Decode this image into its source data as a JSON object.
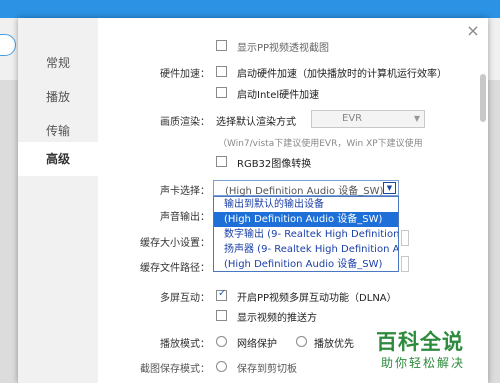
{
  "background": {
    "right_icon": "≡"
  },
  "dialog": {
    "close_label": "×",
    "sidebar": {
      "items": [
        {
          "label": "常规"
        },
        {
          "label": "播放"
        },
        {
          "label": "传输"
        },
        {
          "label": "高级"
        }
      ],
      "active": "高级"
    },
    "rows": {
      "top_partial": "显示PP视频透视截图",
      "hw_accel_label": "硬件加速：",
      "hw_accel_option": "启动硬件加速（加快播放时的计算机运行效率）",
      "intel_option": "启动Intel硬件加速",
      "render_label": "画质渲染：",
      "render_choose": "选择默认渲染方式",
      "render_value": "EVR",
      "render_hint": "（Win7/vista下建议使用EVR，Win XP下建议使用",
      "rgb32_option": "RGB32图像转换",
      "sound_card_label": "声卡选择：",
      "sound_card_value": "(High Definition Audio 设备_SW)",
      "sound_output_label": "声音输出：",
      "cache_size_label": "缓存大小设置：",
      "cache_path_label": "缓存文件路径：",
      "multiscreen_label": "多屏互动：",
      "multiscreen_option": "开启PP视频多屏互动功能（DLNA）",
      "push_option": "显示视频的推送方",
      "play_mode_label": "播放模式：",
      "play_mode_network": "网络保护",
      "play_mode_play": "播放优先",
      "screenshot_label": "截图保存模式：",
      "screenshot_option": "保存到剪切板"
    },
    "sound_dropdown": {
      "options": [
        "输出到默认的输出设备",
        "(High Definition Audio 设备_SW)",
        "数字输出 (9- Realtek High Definition Audio_SW)",
        "扬声器 (9- Realtek High Definition Audio_SW)",
        "(High Definition Audio 设备_SW)"
      ],
      "selected_index": 1
    },
    "checks": {
      "top_partial": false,
      "hw_accel": false,
      "intel": false,
      "rgb32": false,
      "multiscreen": true,
      "push": false
    }
  },
  "watermark": {
    "title": "百科全说",
    "subtitle": "助你轻松解决"
  },
  "colors": {
    "accent": "#1e70d8",
    "brand_green": "#2e8b3e",
    "header_blue": "#2b92e4"
  }
}
